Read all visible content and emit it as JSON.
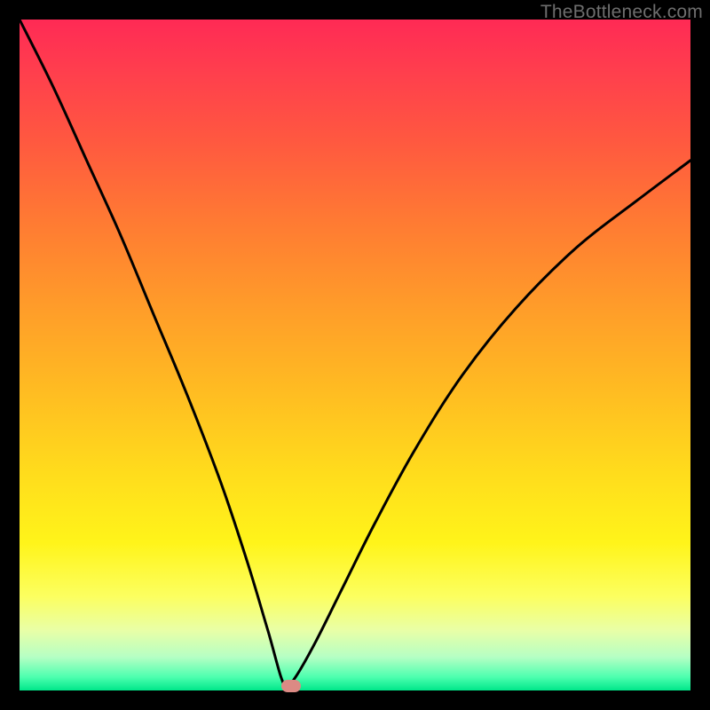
{
  "watermark": "TheBottleneck.com",
  "colors": {
    "frame": "#000000",
    "curve": "#000000",
    "marker": "#dc8a84",
    "gradient_top": "#ff2a55",
    "gradient_bottom": "#00e78a"
  },
  "chart_data": {
    "type": "line",
    "title": "",
    "xlabel": "",
    "ylabel": "",
    "xlim": [
      0,
      100
    ],
    "ylim": [
      0,
      100
    ],
    "series": [
      {
        "name": "bottleneck-curve",
        "x": [
          0,
          5,
          10,
          15,
          20,
          25,
          30,
          34,
          37,
          39.5,
          41,
          44,
          48,
          53,
          59,
          66,
          74,
          83,
          92,
          100
        ],
        "values": [
          100,
          90,
          79,
          68,
          56,
          44,
          31,
          19,
          9,
          0.7,
          1.8,
          7,
          15,
          25,
          36,
          47,
          57,
          66,
          73,
          79
        ]
      }
    ],
    "annotations": [
      {
        "name": "min-marker",
        "x": 40.5,
        "y": 0.7
      }
    ]
  }
}
